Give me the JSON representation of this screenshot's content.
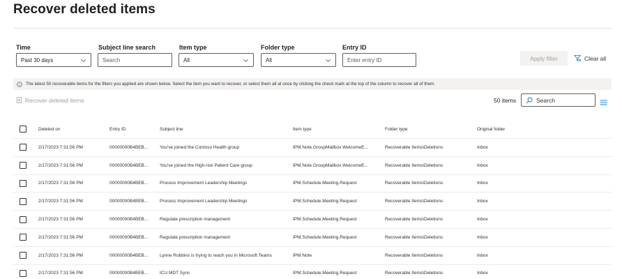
{
  "page": {
    "title": "Recover deleted items"
  },
  "filters": {
    "time": {
      "label": "Time",
      "value": "Past 30 days"
    },
    "subject": {
      "label": "Subject line search",
      "placeholder": "Search"
    },
    "item_type": {
      "label": "Item type",
      "value": "All"
    },
    "folder_type": {
      "label": "Folder type",
      "value": "All"
    },
    "entry_id": {
      "label": "Entry ID",
      "placeholder": "Enter entry ID"
    },
    "apply_label": "Apply filter",
    "clear_label": "Clear all"
  },
  "info_message": "The latest 50 recoverable items for the filters you applied are shown below. Select the item you want to recover, or select them all at once by clicking the check mark at the top of the column to recover all of them.",
  "toolbar": {
    "recover_label": "Recover deleted items",
    "count_label": "50 items",
    "search_placeholder": "Search"
  },
  "table": {
    "columns": [
      "Deleted on",
      "Entry ID",
      "Subject line",
      "Item type",
      "Folder type",
      "Original folder"
    ],
    "rows": [
      [
        "2/17/2023 7:31:56 PM",
        "00000000B4BEB...",
        "You've joined the Contoso Health group",
        "IPM.Note.GroupMailbox.WelcomeE...",
        "Recoverable Items\\Deletions",
        "Inbox"
      ],
      [
        "2/17/2023 7:31:56 PM",
        "00000000B4BEB...",
        "You've joined the High-risk Patient Care group",
        "IPM.Note.GroupMailbox.WelcomeE...",
        "Recoverable Items\\Deletions",
        "Inbox"
      ],
      [
        "2/17/2023 7:31:56 PM",
        "00000000B4BEB...",
        "Process Improvement Leadership Meetings",
        "IPM.Schedule.Meeting.Request",
        "Recoverable Items\\Deletions",
        "Inbox"
      ],
      [
        "2/17/2023 7:31:56 PM",
        "00000000B4BEB...",
        "Process Improvement Leadership Meetings",
        "IPM.Schedule.Meeting.Request",
        "Recoverable Items\\Deletions",
        "Inbox"
      ],
      [
        "2/17/2023 7:31:56 PM",
        "00000000B4BEB...",
        "Regulate prescription management",
        "IPM.Schedule.Meeting.Request",
        "Recoverable Items\\Deletions",
        "Inbox"
      ],
      [
        "2/17/2023 7:31:56 PM",
        "00000000B4BEB...",
        "Regulate prescription management",
        "IPM.Schedule.Meeting.Request",
        "Recoverable Items\\Deletions",
        "Inbox"
      ],
      [
        "2/17/2023 7:31:56 PM",
        "00000000B4BEB...",
        "Lynne Robbins is trying to reach you in Microsoft Teams",
        "IPM.Note",
        "Recoverable Items\\Deletions",
        "Inbox"
      ],
      [
        "2/17/2023 7:31:56 PM",
        "00000000B4BEB...",
        "ICU MDT Sync",
        "IPM.Schedule.Meeting.Request",
        "Recoverable Items\\Deletions",
        "Inbox"
      ]
    ]
  },
  "icons": {
    "chevron": "chevron-down-icon",
    "filter": "filter-clear-icon",
    "info": "info-icon",
    "recover": "recover-icon",
    "search": "search-icon",
    "list": "list-options-icon"
  }
}
